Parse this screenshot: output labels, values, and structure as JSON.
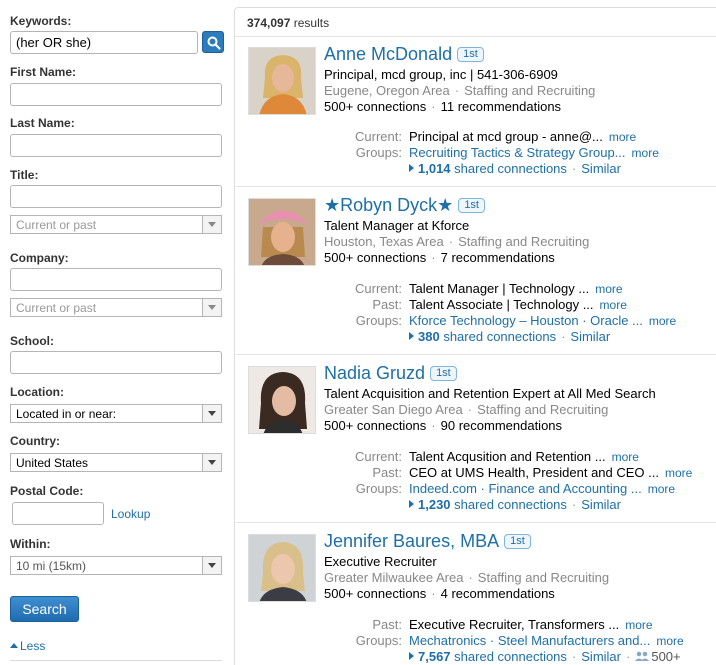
{
  "filters": {
    "keywords_label": "Keywords:",
    "keywords_value": "(her OR she)",
    "first_name_label": "First Name:",
    "last_name_label": "Last Name:",
    "title_label": "Title:",
    "title_scope": "Current or past",
    "company_label": "Company:",
    "company_scope": "Current or past",
    "school_label": "School:",
    "location_label": "Location:",
    "location_value": "Located in or near:",
    "country_label": "Country:",
    "country_value": "United States",
    "postal_label": "Postal Code:",
    "lookup_label": "Lookup",
    "within_label": "Within:",
    "within_value": "10 mi (15km)",
    "search_button": "Search",
    "less_link": "Less"
  },
  "results": {
    "count": "374,097",
    "count_suffix": "results",
    "people": [
      {
        "name": "Anne McDonald",
        "degree": "1st",
        "headline": "Principal, mcd group, inc | 541-306-6909",
        "location": "Eugene, Oregon Area",
        "industry": "Staffing and Recruiting",
        "connections": "500+ connections",
        "recommendations": "11 recommendations",
        "rows": [
          {
            "k": "Current:",
            "v": "Principal at mcd group - anne@...",
            "more": "more",
            "link": false
          },
          {
            "k": "Groups:",
            "v": "Recruiting Tactics & Strategy Group...",
            "more": "more",
            "link": true
          }
        ],
        "shared_count": "1,014",
        "shared_text": "shared connections",
        "similar": "Similar"
      },
      {
        "name": "★Robyn Dyck★",
        "degree": "1st",
        "headline": "Talent Manager at Kforce",
        "location": "Houston, Texas Area",
        "industry": "Staffing and Recruiting",
        "connections": "500+ connections",
        "recommendations": "7 recommendations",
        "rows": [
          {
            "k": "Current:",
            "v": "Talent Manager | Technology ...",
            "more": "more",
            "link": false
          },
          {
            "k": "Past:",
            "v": "Talent Associate | Technology ...",
            "more": "more",
            "link": false
          },
          {
            "k": "Groups:",
            "v": "Kforce Technology – Houston · Oracle ...",
            "more": "more",
            "link": true
          }
        ],
        "shared_count": "380",
        "shared_text": "shared connections",
        "similar": "Similar"
      },
      {
        "name": "Nadia Gruzd",
        "degree": "1st",
        "headline": "Talent Acquisition and Retention Expert at All Med Search",
        "location": "Greater San Diego Area",
        "industry": "Staffing and Recruiting",
        "connections": "500+ connections",
        "recommendations": "90 recommendations",
        "rows": [
          {
            "k": "Current:",
            "v": "Talent Acqusition and Retention ...",
            "more": "more",
            "link": false
          },
          {
            "k": "Past:",
            "v": "CEO at UMS Health, President and CEO ...",
            "more": "more",
            "link": false
          },
          {
            "k": "Groups:",
            "v": "Indeed.com · Finance and Accounting ...",
            "more": "more",
            "link": true
          }
        ],
        "shared_count": "1,230",
        "shared_text": "shared connections",
        "similar": "Similar"
      },
      {
        "name": "Jennifer Baures, MBA",
        "degree": "1st",
        "headline": "Executive Recruiter",
        "location": "Greater Milwaukee Area",
        "industry": "Staffing and Recruiting",
        "connections": "500+ connections",
        "recommendations": "4 recommendations",
        "rows": [
          {
            "k": "Past:",
            "v": "Executive Recruiter, Transformers ...",
            "more": "more",
            "link": false
          },
          {
            "k": "Groups:",
            "v": "Mechatronics · Steel Manufacturers and...",
            "more": "more",
            "link": true
          }
        ],
        "shared_count": "7,567",
        "shared_text": "shared connections",
        "similar": "Similar",
        "extra": "500+"
      }
    ]
  },
  "colors": {
    "link": "#1e6fa8",
    "button": "#2c7bbb"
  }
}
